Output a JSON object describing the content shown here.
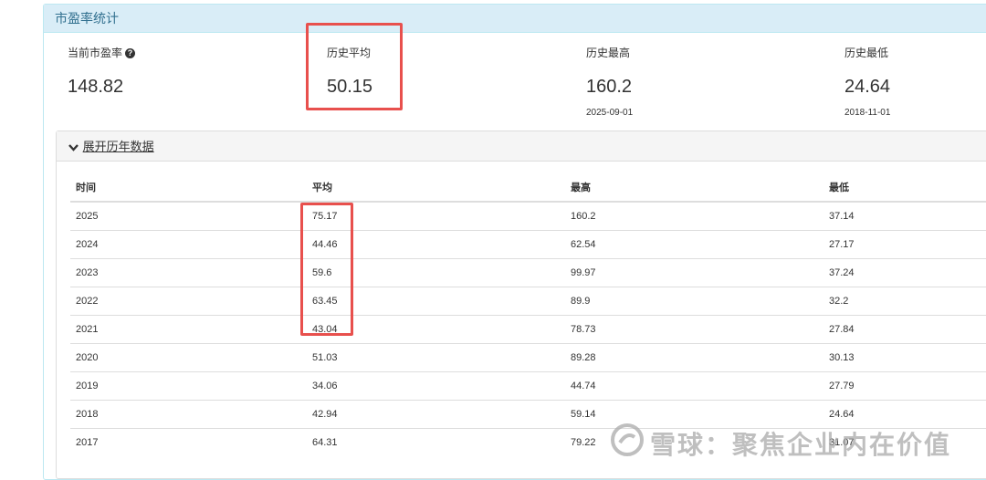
{
  "panel": {
    "title": "市盈率统计"
  },
  "stats": {
    "current": {
      "label": "当前市盈率",
      "value": "148.82",
      "help_icon": "question-circle-icon"
    },
    "avg": {
      "label": "历史平均",
      "value": "50.15"
    },
    "high": {
      "label": "历史最高",
      "value": "160.2",
      "date": "2025-09-01"
    },
    "low": {
      "label": "历史最低",
      "value": "24.64",
      "date": "2018-11-01"
    }
  },
  "history": {
    "toggle_label": "展开历年数据",
    "toggle_icon": "chevron-down-icon",
    "headers": [
      "时间",
      "平均",
      "最高",
      "最低"
    ],
    "rows": [
      [
        "2025",
        "75.17",
        "160.2",
        "37.14"
      ],
      [
        "2024",
        "44.46",
        "62.54",
        "27.17"
      ],
      [
        "2023",
        "59.6",
        "99.97",
        "37.24"
      ],
      [
        "2022",
        "63.45",
        "89.9",
        "32.2"
      ],
      [
        "2021",
        "43.04",
        "78.73",
        "27.84"
      ],
      [
        "2020",
        "51.03",
        "89.28",
        "30.13"
      ],
      [
        "2019",
        "34.06",
        "44.74",
        "27.79"
      ],
      [
        "2018",
        "42.94",
        "59.14",
        "24.64"
      ],
      [
        "2017",
        "64.31",
        "79.22",
        "31.07"
      ]
    ]
  },
  "watermark": {
    "text": "雪球：聚焦企业内在价值",
    "icon": "snowball-logo-icon"
  },
  "colors": {
    "highlight": "#e8504d",
    "heading_bg": "#d9edf7",
    "heading_text": "#31708f"
  }
}
